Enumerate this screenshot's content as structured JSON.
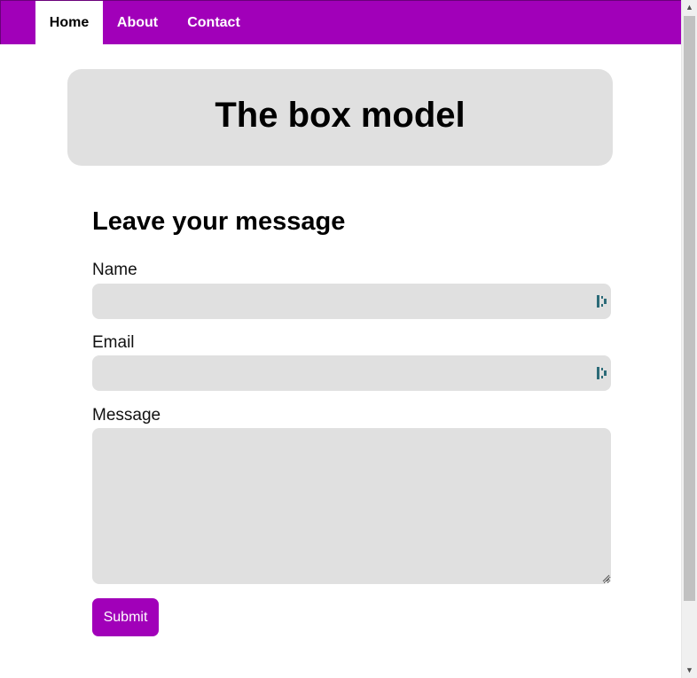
{
  "nav": {
    "items": [
      {
        "label": "Home",
        "active": true
      },
      {
        "label": "About",
        "active": false
      },
      {
        "label": "Contact",
        "active": false
      }
    ]
  },
  "banner": {
    "title": "The box model"
  },
  "form": {
    "title": "Leave your message",
    "name_label": "Name",
    "name_value": "",
    "email_label": "Email",
    "email_value": "",
    "message_label": "Message",
    "message_value": "",
    "submit_label": "Submit"
  },
  "scrollbar": {
    "up_icon": "arrow-up-icon",
    "down_icon": "arrow-down-icon"
  },
  "colors": {
    "accent": "#a100b9",
    "field_bg": "#e0e0e0",
    "banner_bg": "#e0e0e0"
  }
}
